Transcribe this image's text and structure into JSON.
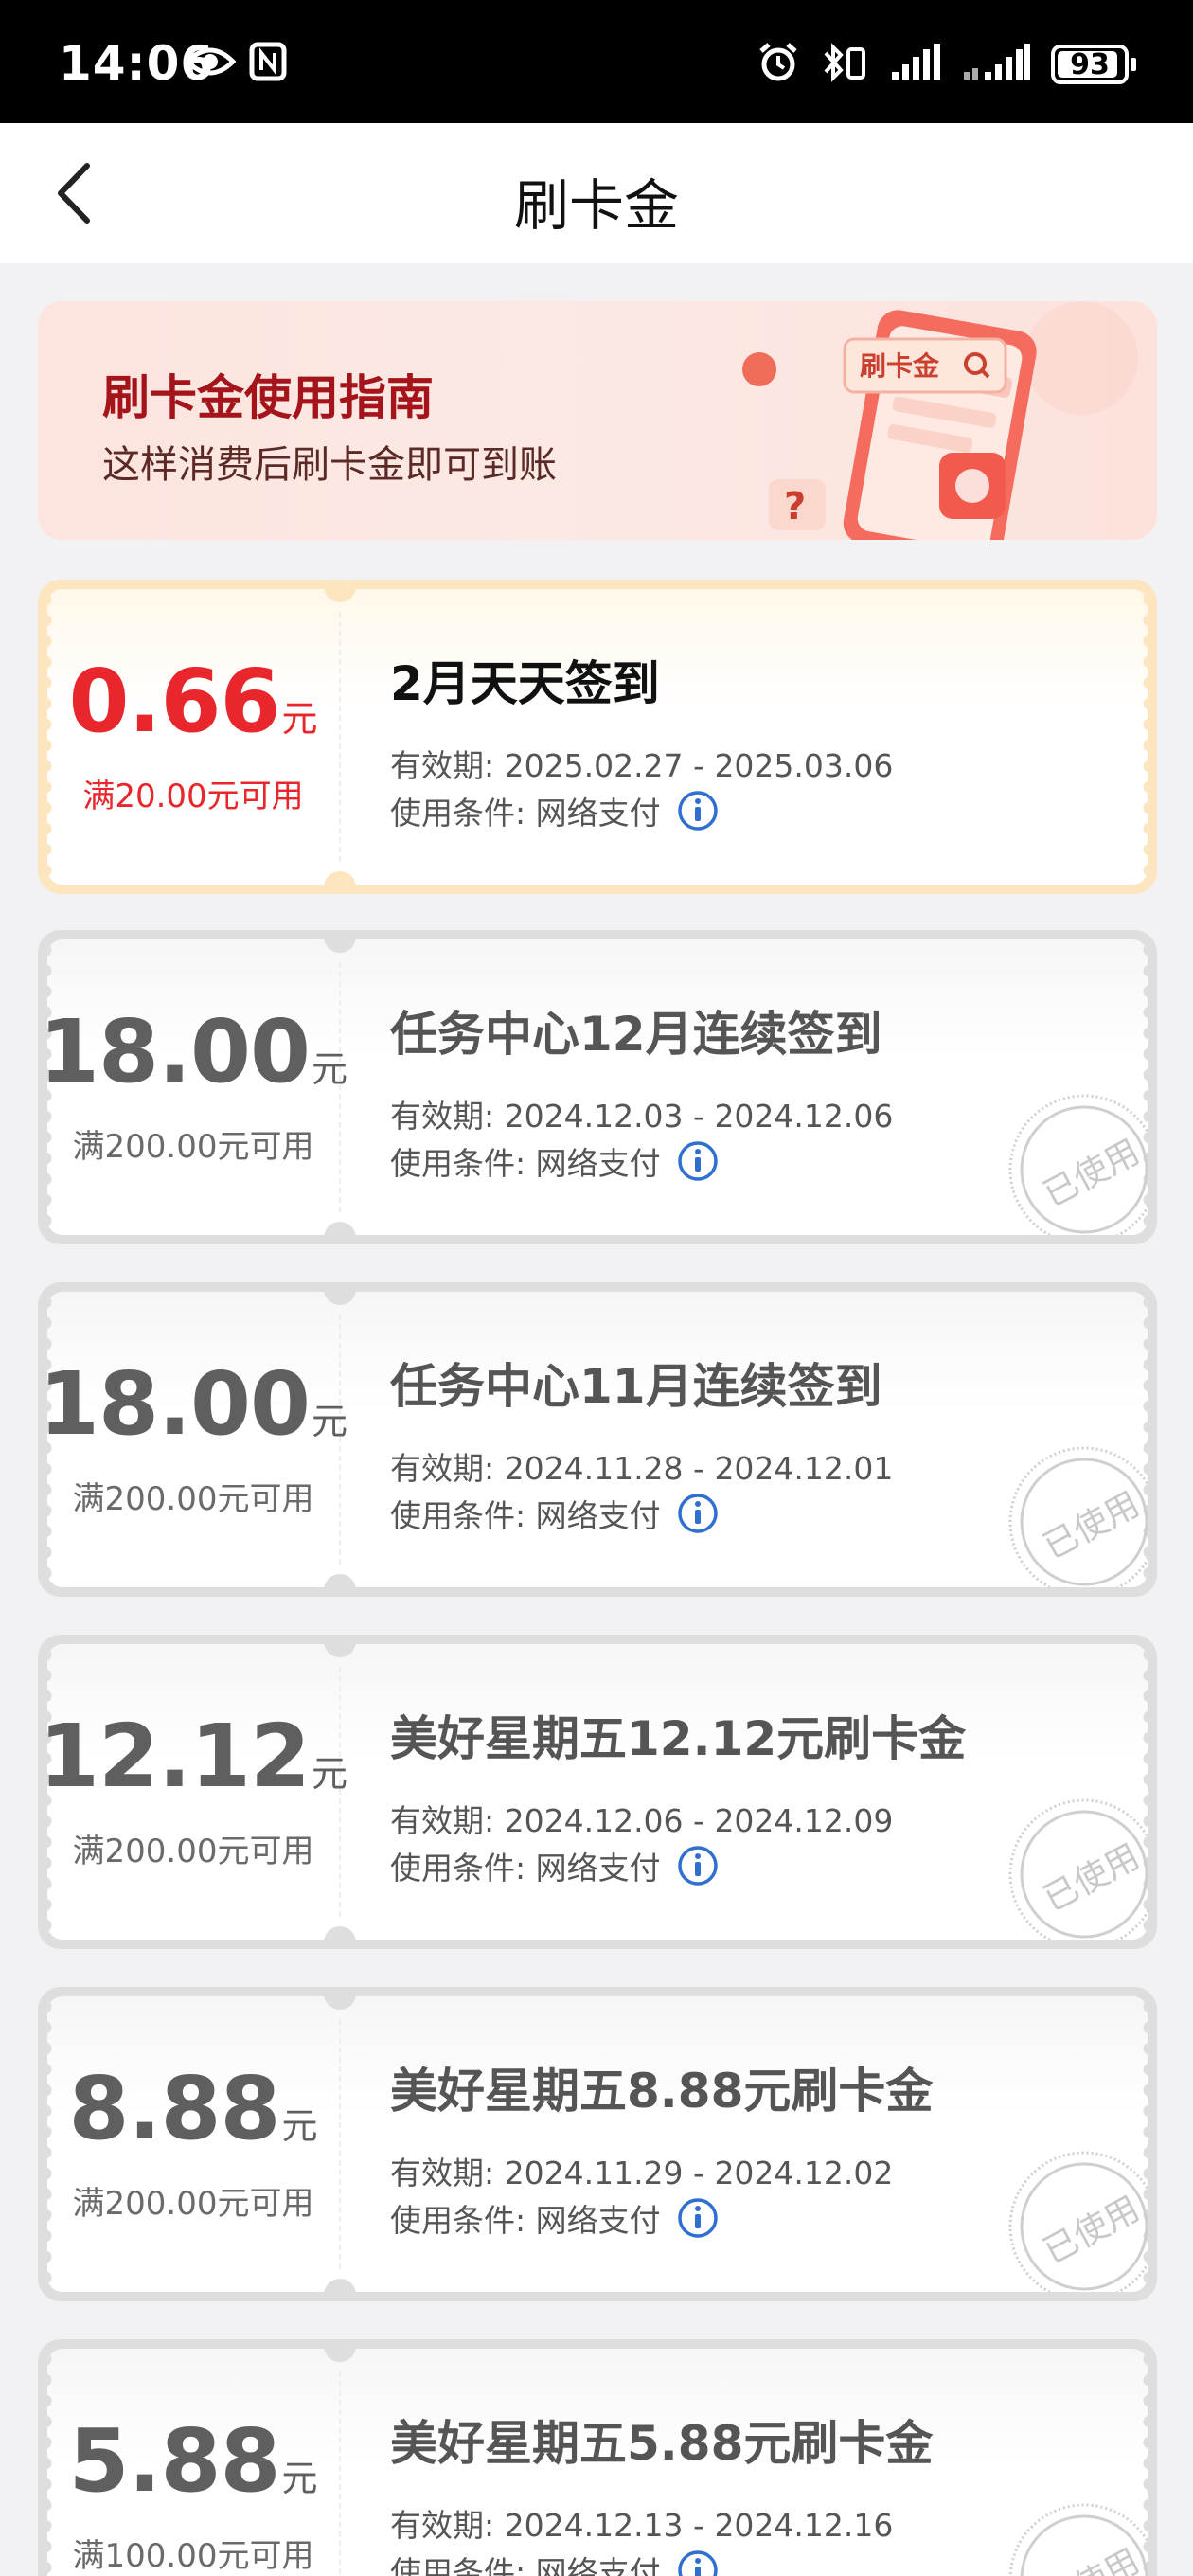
{
  "status_bar": {
    "time": "14:06",
    "battery": "93",
    "battery_level": 0.93,
    "icons": [
      "eye-icon",
      "nfc-icon",
      "alarm-icon",
      "bluetooth-icon",
      "signal-icon",
      "signal-icon"
    ]
  },
  "header": {
    "title": "刷卡金",
    "back_icon": "back-arrow-icon"
  },
  "banner": {
    "title": "刷卡金使用指南",
    "subtitle": "这样消费后刷卡金即可到账",
    "art_label": "刷卡金"
  },
  "colors": {
    "active_red": "#e8262b",
    "active_border": "#fde6bf",
    "used_border": "#dedede",
    "info_blue": "#2f6fd0",
    "banner_title": "#a4141a"
  },
  "coupons": [
    {
      "status": "active",
      "amount": "0.66",
      "unit": "元",
      "threshold": "满20.00元可用",
      "title": "2月天天签到",
      "validity": "有效期: 2025.02.27 - 2025.03.06",
      "condition": "使用条件:  网络支付",
      "stamp": ""
    },
    {
      "status": "used",
      "amount": "18.00",
      "unit": "元",
      "threshold": "满200.00元可用",
      "title": "任务中心12月连续签到",
      "validity": "有效期: 2024.12.03 - 2024.12.06",
      "condition": "使用条件:  网络支付",
      "stamp": "已使用"
    },
    {
      "status": "used",
      "amount": "18.00",
      "unit": "元",
      "threshold": "满200.00元可用",
      "title": "任务中心11月连续签到",
      "validity": "有效期: 2024.11.28 - 2024.12.01",
      "condition": "使用条件:  网络支付",
      "stamp": "已使用"
    },
    {
      "status": "used",
      "amount": "12.12",
      "unit": "元",
      "threshold": "满200.00元可用",
      "title": "美好星期五12.12元刷卡金",
      "validity": "有效期: 2024.12.06 - 2024.12.09",
      "condition": "使用条件:  网络支付",
      "stamp": "已使用"
    },
    {
      "status": "used",
      "amount": "8.88",
      "unit": "元",
      "threshold": "满200.00元可用",
      "title": "美好星期五8.88元刷卡金",
      "validity": "有效期: 2024.11.29 - 2024.12.02",
      "condition": "使用条件:  网络支付",
      "stamp": "已使用"
    },
    {
      "status": "used",
      "amount": "5.88",
      "unit": "元",
      "threshold": "满100.00元可用",
      "title": "美好星期五5.88元刷卡金",
      "validity": "有效期: 2024.12.13 - 2024.12.16",
      "condition": "使用条件:  网络支付",
      "stamp": "已使用"
    }
  ]
}
